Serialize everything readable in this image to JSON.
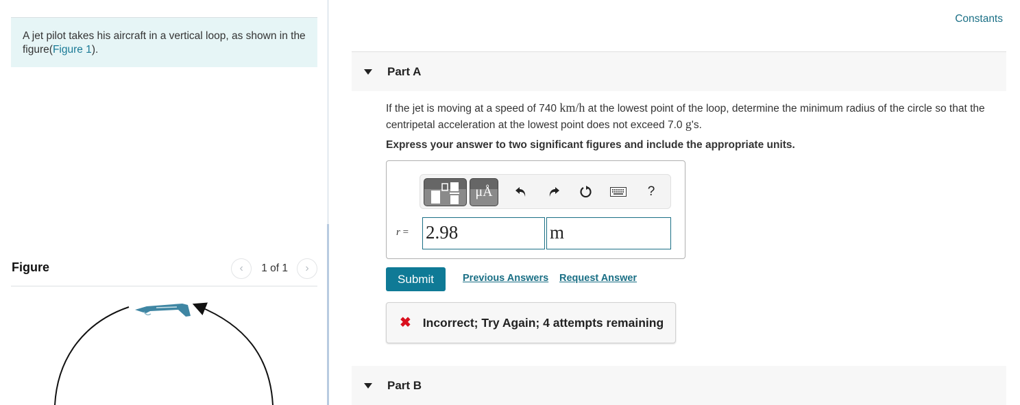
{
  "intro": {
    "text": "A jet pilot takes his aircraft in a vertical loop, as shown in the figure(",
    "figure_link": "Figure 1",
    "text_end": ")."
  },
  "figure_panel": {
    "title": "Figure",
    "pager_text": "1 of 1",
    "prev_icon": "chevron-left-icon",
    "next_icon": "chevron-right-icon"
  },
  "constants_link": "Constants",
  "part_a": {
    "label": "Part A",
    "question_pre": "If the jet is moving at a speed of 740 ",
    "question_unit": "km/h",
    "question_mid": " at the lowest point of the loop, determine the minimum radius of the circle so that the centripetal acceleration at the lowest point does not exceed 7.0 ",
    "question_g": "g",
    "question_end": "'s.",
    "instruction": "Express your answer to two significant figures and include the appropriate units.",
    "toolbar": {
      "templates_icon": "templates-icon",
      "units_label": "μÅ",
      "undo_icon": "undo-icon",
      "redo_icon": "redo-icon",
      "reset_icon": "reset-icon",
      "keyboard_icon": "keyboard-icon",
      "help_label": "?"
    },
    "variable": "r",
    "equals": "=",
    "answer_value": "2.98",
    "answer_unit": "m",
    "submit_label": "Submit",
    "previous_answers_label": "Previous Answers",
    "request_answer_label": "Request Answer",
    "feedback": {
      "icon": "x-icon",
      "icon_glyph": "✖",
      "text": "Incorrect; Try Again; 4 attempts remaining",
      "color": "#d9101e"
    }
  },
  "part_b": {
    "label": "Part B"
  },
  "colors": {
    "accent": "#0f7a96",
    "link": "#1a6f85",
    "intro_bg": "#e6f5f6",
    "jet": "#3f86a3"
  }
}
